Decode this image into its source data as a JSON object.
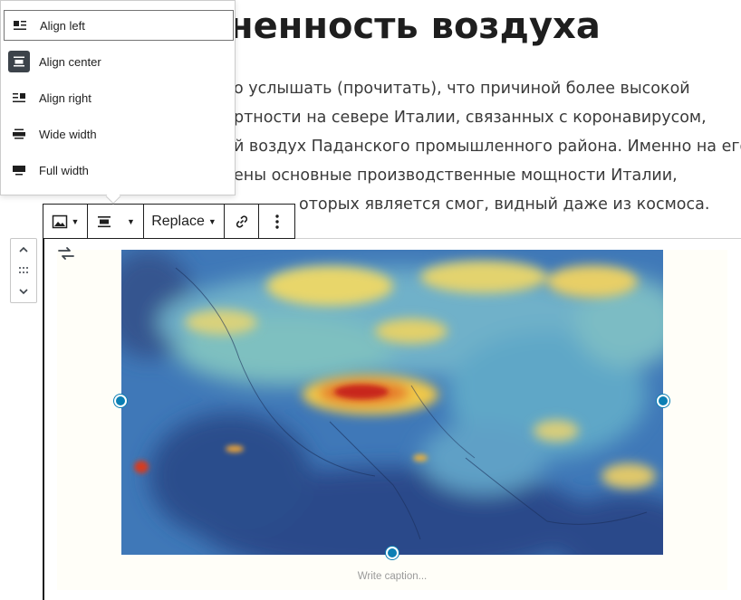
{
  "post": {
    "title": "ненность воздуха",
    "paragraph_lines": [
      "о услышать (прочитать), что причиной более высокой",
      "ртности на севере Италии, связанных с коронавирусом,",
      "й воздух Паданского промышленного района. Именно на его",
      "ены основные производственные мощности Италии,",
      "оторых является смог, видный даже из космоса."
    ]
  },
  "align_menu": {
    "items": [
      {
        "label": "Align left",
        "icon": "align-left-icon"
      },
      {
        "label": "Align center",
        "icon": "align-center-icon"
      },
      {
        "label": "Align right",
        "icon": "align-right-icon"
      },
      {
        "label": "Wide width",
        "icon": "wide-width-icon"
      },
      {
        "label": "Full width",
        "icon": "full-width-icon"
      }
    ],
    "focused_item": "Align left",
    "active_item": "Align center"
  },
  "toolbar": {
    "block_type_icon": "image-icon",
    "align_icon": "align-center-icon",
    "replace_label": "Replace",
    "link_icon": "link-icon",
    "more_icon": "more-vertical-icon"
  },
  "mover": {
    "up_icon": "chevron-up-icon",
    "drag_icon": "drag-handle-icon",
    "down_icon": "chevron-down-icon"
  },
  "image_block": {
    "replace_icon": "swap-icon",
    "caption_placeholder": "Write caption..."
  },
  "colors": {
    "accent": "#0b7fb4",
    "toolbar_border": "#1e1e1e",
    "caption_bg": "#fffef8"
  }
}
